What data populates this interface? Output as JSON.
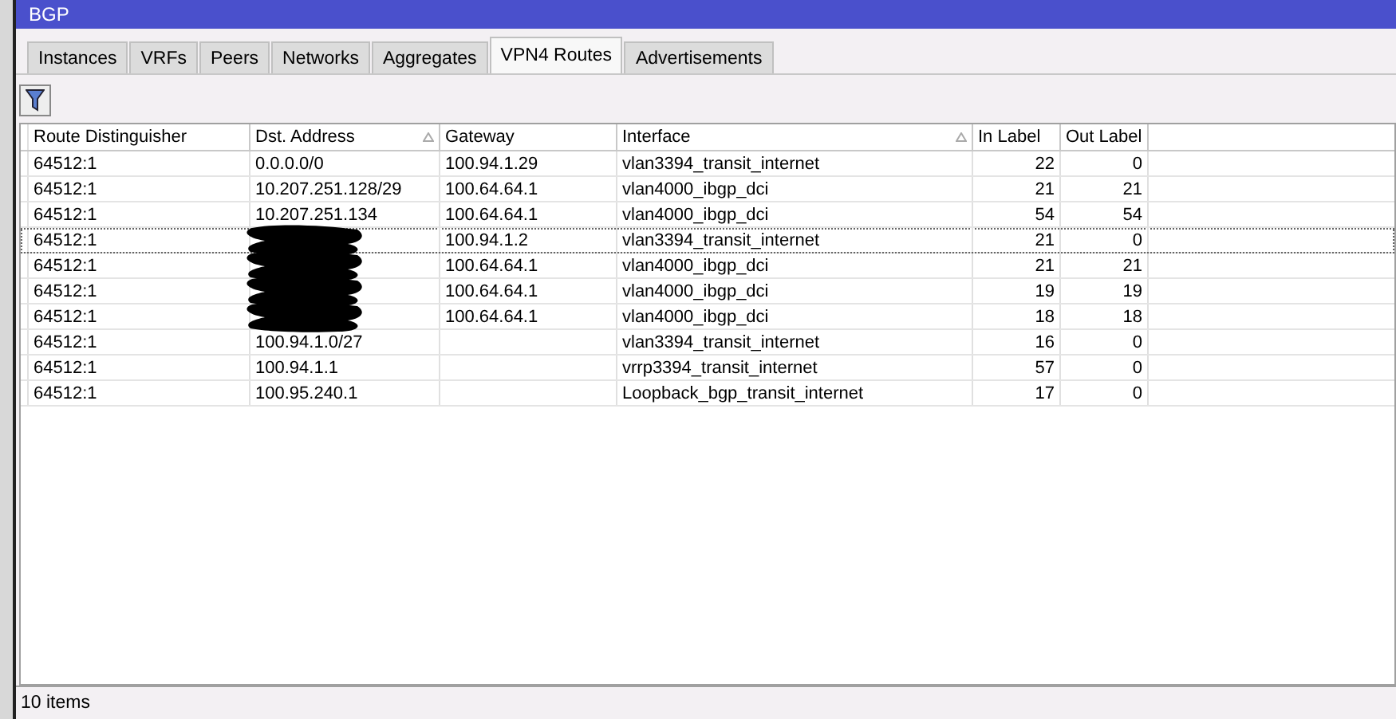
{
  "window": {
    "title": "BGP"
  },
  "tabs": [
    {
      "label": "Instances",
      "selected": false
    },
    {
      "label": "VRFs",
      "selected": false
    },
    {
      "label": "Peers",
      "selected": false
    },
    {
      "label": "Networks",
      "selected": false
    },
    {
      "label": "Aggregates",
      "selected": false
    },
    {
      "label": "VPN4 Routes",
      "selected": true
    },
    {
      "label": "Advertisements",
      "selected": false
    }
  ],
  "table": {
    "columns": [
      {
        "label": "Route Distinguisher",
        "sorted": false
      },
      {
        "label": "Dst. Address",
        "sorted": true
      },
      {
        "label": "Gateway",
        "sorted": false
      },
      {
        "label": "Interface",
        "sorted": true
      },
      {
        "label": "In Label",
        "sorted": false
      },
      {
        "label": "Out Label",
        "sorted": false
      }
    ],
    "rows": [
      {
        "focused": false,
        "redacted": false,
        "cells": [
          "64512:1",
          "0.0.0.0/0",
          "100.94.1.29",
          "vlan3394_transit_internet",
          "22",
          "0"
        ]
      },
      {
        "focused": false,
        "redacted": false,
        "cells": [
          "64512:1",
          "10.207.251.128/29",
          "100.64.64.1",
          "vlan4000_ibgp_dci",
          "21",
          "21"
        ]
      },
      {
        "focused": false,
        "redacted": false,
        "cells": [
          "64512:1",
          "10.207.251.134",
          "100.64.64.1",
          "vlan4000_ibgp_dci",
          "54",
          "54"
        ]
      },
      {
        "focused": true,
        "redacted": true,
        "cells": [
          "64512:1",
          "",
          "100.94.1.2",
          "vlan3394_transit_internet",
          "21",
          "0"
        ]
      },
      {
        "focused": false,
        "redacted": true,
        "cells": [
          "64512:1",
          "",
          "100.64.64.1",
          "vlan4000_ibgp_dci",
          "21",
          "21"
        ]
      },
      {
        "focused": false,
        "redacted": true,
        "cells": [
          "64512:1",
          "",
          "100.64.64.1",
          "vlan4000_ibgp_dci",
          "19",
          "19"
        ]
      },
      {
        "focused": false,
        "redacted": true,
        "cells": [
          "64512:1",
          "",
          "100.64.64.1",
          "vlan4000_ibgp_dci",
          "18",
          "18"
        ]
      },
      {
        "focused": false,
        "redacted": false,
        "cells": [
          "64512:1",
          "100.94.1.0/27",
          "",
          "vlan3394_transit_internet",
          "16",
          "0"
        ]
      },
      {
        "focused": false,
        "redacted": false,
        "cells": [
          "64512:1",
          "100.94.1.1",
          "",
          "vrrp3394_transit_internet",
          "57",
          "0"
        ]
      },
      {
        "focused": false,
        "redacted": false,
        "cells": [
          "64512:1",
          "100.95.240.1",
          "",
          "Loopback_bgp_transit_internet",
          "17",
          "0"
        ]
      }
    ]
  },
  "status_bar": {
    "text": "10 items"
  }
}
